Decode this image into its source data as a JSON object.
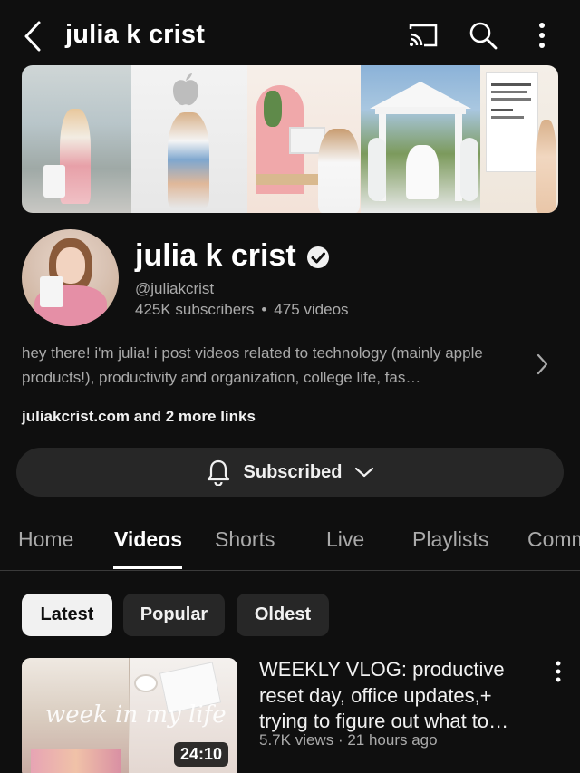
{
  "header": {
    "title": "julia k crist",
    "back_icon": "chevron-left-icon",
    "cast_icon": "cast-icon",
    "search_icon": "search-icon",
    "more_icon": "vertical-dots-icon"
  },
  "channel": {
    "name": "julia k crist",
    "handle": "@juliakcrist",
    "subscribers": "425K subscribers",
    "videos": "475 videos",
    "stats_separator": "•",
    "verified_icon": "verified-check-icon",
    "description": "hey there! i'm julia! i post videos related to technology (mainly apple products!), productivity and organization, college life, fas…",
    "links": "juliakcrist.com and 2 more links"
  },
  "subscribe": {
    "label": "Subscribed",
    "bell_icon": "bell-icon",
    "chevron_icon": "chevron-down-icon"
  },
  "tabs": [
    {
      "label": "Home"
    },
    {
      "label": "Videos",
      "active": true
    },
    {
      "label": "Shorts"
    },
    {
      "label": "Live"
    },
    {
      "label": "Playlists"
    },
    {
      "label": "Comm"
    }
  ],
  "filters": [
    {
      "label": "Latest",
      "active": true
    },
    {
      "label": "Popular"
    },
    {
      "label": "Oldest"
    }
  ],
  "videos": [
    {
      "title": "WEEKLY VLOG: productive reset day, office updates,+ trying to figure out what to…",
      "views": "5.7K views",
      "age": "21 hours ago",
      "meta_separator": "·",
      "duration": "24:10",
      "thumbnail_text": "week in my life"
    }
  ],
  "colors": {
    "background": "#0f0f0f",
    "surface": "#272727",
    "text_primary": "#f1f1f1",
    "text_secondary": "#aaaaaa"
  }
}
